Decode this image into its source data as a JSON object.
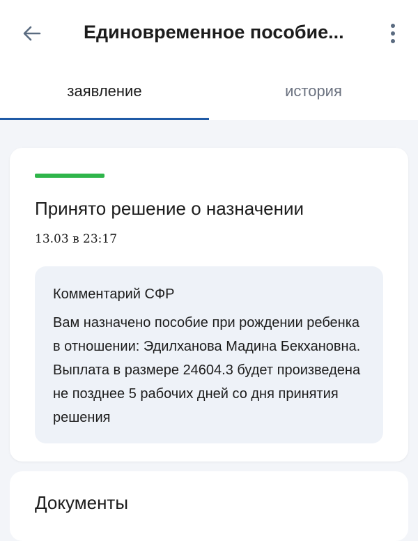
{
  "header": {
    "title": "Единовременное пособие...",
    "back_icon": "arrow-left-icon",
    "more_icon": "more-vertical-icon"
  },
  "tabs": [
    {
      "label": "заявление",
      "active": true
    },
    {
      "label": "история",
      "active": false
    }
  ],
  "status_card": {
    "status_color": "#2fb54a",
    "title": "Принято решение о назначении",
    "time": "13.03 в 23:17",
    "comment": {
      "label": "Комментарий СФР",
      "text": "Вам назначено пособие при рождении ребенка в отношении: Эдилханова Мадина Бекхановна. Выплата в размере 24604.3 будет произведена не позднее 5 рабочих дней со дня принятия решения"
    }
  },
  "documents_card": {
    "title": "Документы"
  },
  "colors": {
    "accent": "#1f5aa6",
    "status_success": "#2fb54a",
    "background": "#f3f5f9"
  }
}
